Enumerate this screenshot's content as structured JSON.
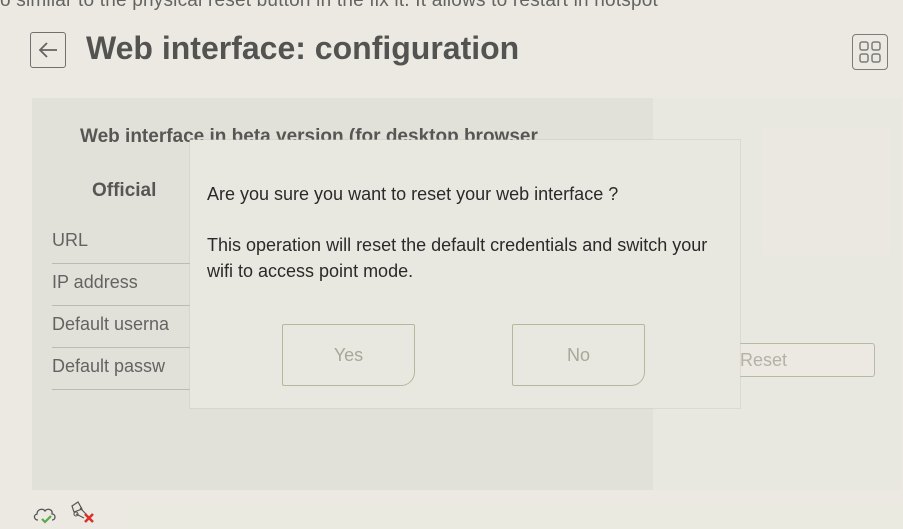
{
  "banner": {
    "text": "o similar to the physical reset button in the fix it. It allows to restart in hotspot"
  },
  "header": {
    "title": "Web interface: configuration"
  },
  "card": {
    "beta_title": "Web interface in beta version (for desktop browser",
    "official_label": "Official",
    "rows": [
      "URL",
      "IP address",
      "Default userna",
      "Default passw"
    ]
  },
  "right_panel": {
    "reset_label": "Reset"
  },
  "dialog": {
    "question": "Are you sure you want to reset your web interface ?",
    "message": "This operation will reset the default credentials and switch your wifi to access point mode.",
    "yes_label": "Yes",
    "no_label": "No"
  },
  "icons": {
    "back": "arrow-left-icon",
    "grid": "grid-icon",
    "cloud": "cloud-check-icon",
    "network": "network-error-icon"
  },
  "colors": {
    "background": "#e8e6dd",
    "panel": "#dddbd2",
    "accent_green": "#5aa84a",
    "error_red": "#d9322b"
  }
}
